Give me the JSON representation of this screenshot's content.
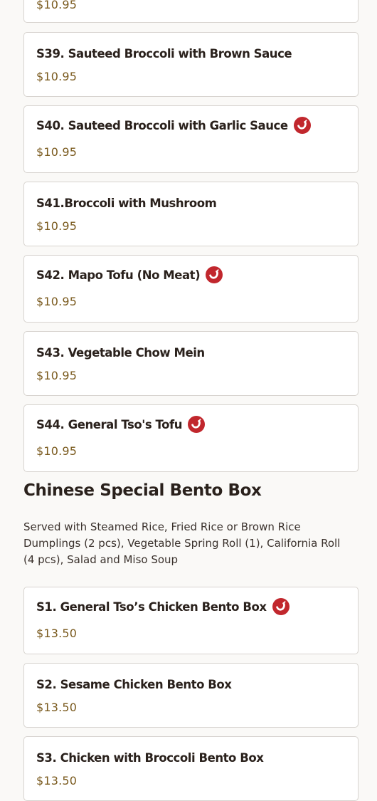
{
  "colors": {
    "background": "#faf9f7",
    "card_border": "#d7d3cf",
    "price": "#7a5a1e",
    "spicy_badge": "#c1272d"
  },
  "previous_items": [
    {
      "name": "",
      "price": "$10.95",
      "spicy": false
    },
    {
      "name": "S39. Sauteed Broccoli with Brown Sauce",
      "price": "$10.95",
      "spicy": false
    },
    {
      "name": "S40. Sauteed Broccoli with Garlic Sauce",
      "price": "$10.95",
      "spicy": true,
      "icon": "chili-pepper-icon"
    },
    {
      "name": "S41.Broccoli with Mushroom",
      "price": "$10.95",
      "spicy": false
    },
    {
      "name": "S42. Mapo Tofu (No Meat)",
      "price": "$10.95",
      "spicy": true,
      "icon": "chili-pepper-icon"
    },
    {
      "name": "S43. Vegetable Chow Mein",
      "price": "$10.95",
      "spicy": false
    },
    {
      "name": "S44. General Tso's Tofu",
      "price": "$10.95",
      "spicy": true,
      "icon": "chili-pepper-icon"
    }
  ],
  "bento_section": {
    "title": "Chinese Special Bento Box",
    "description": "Served with Steamed Rice, Fried Rice or Brown Rice Dumplings (2 pcs), Vegetable Spring Roll (1), California Roll (4 pcs), Salad and Miso Soup",
    "items": [
      {
        "name": "S1. General Tso’s Chicken Bento Box",
        "price": "$13.50",
        "spicy": true,
        "icon": "chili-pepper-icon"
      },
      {
        "name": "S2. Sesame Chicken Bento Box",
        "price": "$13.50",
        "spicy": false
      },
      {
        "name": "S3. Chicken with Broccoli Bento Box",
        "price": "$13.50",
        "spicy": false
      }
    ]
  }
}
